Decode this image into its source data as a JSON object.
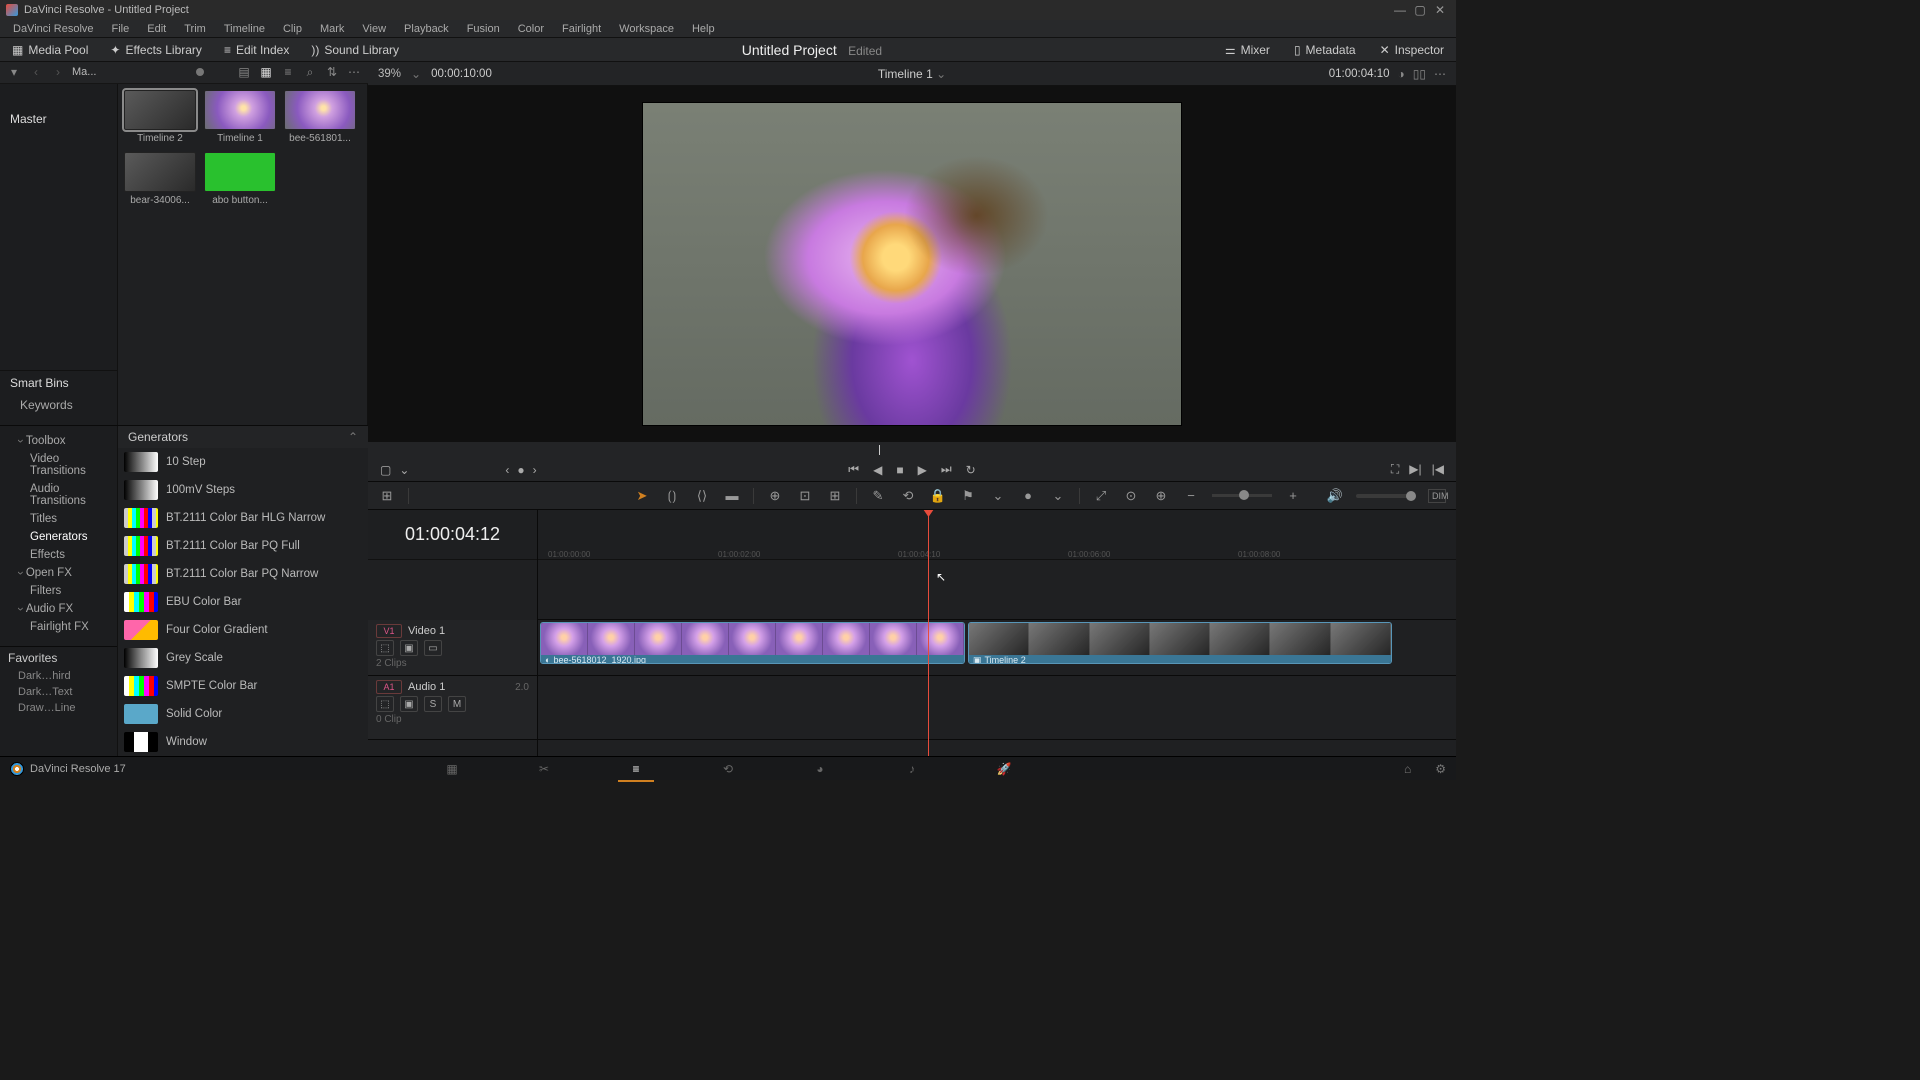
{
  "window": {
    "app": "DaVinci Resolve",
    "title": "DaVinci Resolve - Untitled Project"
  },
  "menu": [
    "DaVinci Resolve",
    "File",
    "Edit",
    "Trim",
    "Timeline",
    "Clip",
    "Mark",
    "View",
    "Playback",
    "Fusion",
    "Color",
    "Fairlight",
    "Workspace",
    "Help"
  ],
  "toolbar": {
    "media_pool": "Media Pool",
    "fx_lib": "Effects Library",
    "edit_index": "Edit Index",
    "sound_lib": "Sound Library",
    "mixer": "Mixer",
    "metadata": "Metadata",
    "inspector": "Inspector",
    "project_title": "Untitled Project",
    "project_status": "Edited"
  },
  "media_header": {
    "title": "Ma...",
    "duration": "00:00:10:00",
    "zoom": "39%"
  },
  "master": "Master",
  "smartbins": {
    "header": "Smart Bins",
    "keywords": "Keywords"
  },
  "clips": [
    {
      "name": "Timeline 2",
      "kind": "bear",
      "selected": true
    },
    {
      "name": "Timeline 1",
      "kind": "flower"
    },
    {
      "name": "bee-561801...",
      "kind": "flower"
    },
    {
      "name": "bear-34006...",
      "kind": "bear"
    },
    {
      "name": "abo button...",
      "kind": "green"
    }
  ],
  "viewer": {
    "title": "Timeline 1",
    "timecode_right": "01:00:04:10"
  },
  "fx": {
    "tree": {
      "toolbox": "Toolbox",
      "video_trans": "Video Transitions",
      "audio_trans": "Audio Transitions",
      "titles": "Titles",
      "generators": "Generators",
      "effects": "Effects",
      "openfx": "Open FX",
      "filters": "Filters",
      "audiofx": "Audio FX",
      "fairlightfx": "Fairlight FX"
    },
    "panel_title": "Generators",
    "list": [
      {
        "n": "10 Step",
        "sw": "grad"
      },
      {
        "n": "100mV Steps",
        "sw": "grad"
      },
      {
        "n": "BT.2111 Color Bar HLG Narrow",
        "sw": "bars"
      },
      {
        "n": "BT.2111 Color Bar PQ Full",
        "sw": "bars"
      },
      {
        "n": "BT.2111 Color Bar PQ Narrow",
        "sw": "bars"
      },
      {
        "n": "EBU Color Bar",
        "sw": "ebu"
      },
      {
        "n": "Four Color Gradient",
        "sw": "4c"
      },
      {
        "n": "Grey Scale",
        "sw": "grey"
      },
      {
        "n": "SMPTE Color Bar",
        "sw": "ebu"
      },
      {
        "n": "Solid Color",
        "sw": "solid"
      },
      {
        "n": "Window",
        "sw": "win"
      }
    ],
    "favorites": {
      "header": "Favorites",
      "items": [
        "Dark…hird",
        "Dark…Text",
        "Draw…Line"
      ]
    }
  },
  "timeline": {
    "timecode": "01:00:04:12",
    "ruler": [
      "01:00:00:00",
      "01:00:02:00",
      "01:00:04:10",
      "01:00:06:00",
      "01:00:08:00"
    ],
    "video": {
      "tag": "V1",
      "name": "Video 1",
      "clips_info": "2 Clips"
    },
    "audio": {
      "tag": "A1",
      "name": "Audio 1",
      "level": "2.0",
      "clips_info": "0 Clip"
    },
    "clip1": {
      "name": "bee-5618012_1920.jpg"
    },
    "clip2": {
      "name": "Timeline 2"
    }
  },
  "footer": {
    "brand": "DaVinci Resolve 17"
  }
}
